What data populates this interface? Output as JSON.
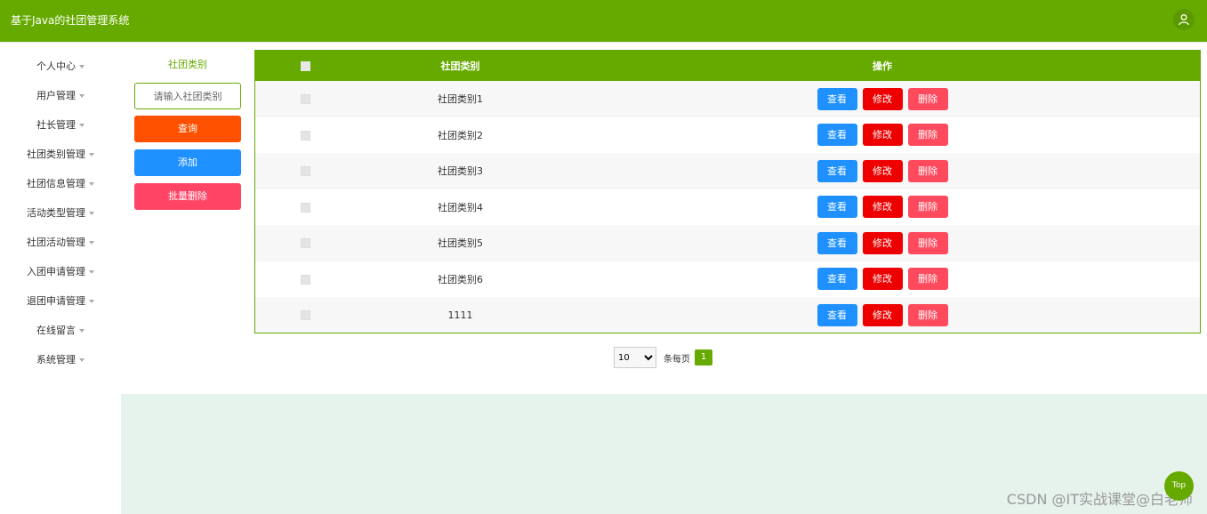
{
  "header": {
    "title": "基于Java的社团管理系统",
    "user_icon": "user-icon"
  },
  "sidebar": {
    "items": [
      {
        "label": "个人中心"
      },
      {
        "label": "用户管理"
      },
      {
        "label": "社长管理"
      },
      {
        "label": "社团类别管理"
      },
      {
        "label": "社团信息管理"
      },
      {
        "label": "活动类型管理"
      },
      {
        "label": "社团活动管理"
      },
      {
        "label": "入团申请管理"
      },
      {
        "label": "退团申请管理"
      },
      {
        "label": "在线留言"
      },
      {
        "label": "系统管理"
      }
    ]
  },
  "filter": {
    "label": "社团类别",
    "placeholder": "请输入社团类别",
    "query_label": "查询",
    "add_label": "添加",
    "bulk_delete_label": "批量删除"
  },
  "table": {
    "headers": [
      "社团类别",
      "操作"
    ],
    "rows": [
      {
        "name": "社团类别1"
      },
      {
        "name": "社团类别2"
      },
      {
        "name": "社团类别3"
      },
      {
        "name": "社团类别4"
      },
      {
        "name": "社团类别5"
      },
      {
        "name": "社团类别6"
      },
      {
        "name": "1111"
      }
    ],
    "actions": {
      "view": "查看",
      "edit": "修改",
      "delete": "删除"
    }
  },
  "pagination": {
    "page_size": "10",
    "per_page_label": "条每页",
    "current_page": "1"
  },
  "watermark": "CSDN @IT实战课堂@白老师",
  "back_to_top": "Top",
  "colors": {
    "primary": "#66aa00",
    "query": "#ff5000",
    "add": "#1e90ff",
    "bulk_delete": "#ff4466",
    "edit": "#ee0000",
    "delete": "#ff4a5e"
  }
}
